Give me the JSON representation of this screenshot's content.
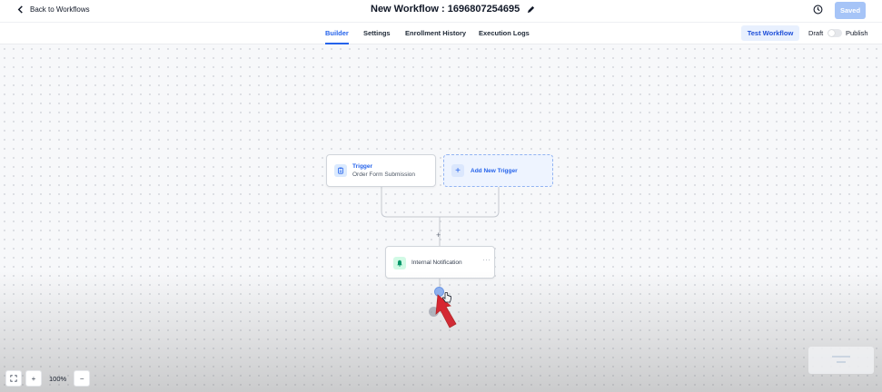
{
  "header": {
    "back_label": "Back to Workflows",
    "workflow_title": "New Workflow : 1696807254695",
    "saved_label": "Saved"
  },
  "tabs": [
    {
      "label": "Builder",
      "active": true
    },
    {
      "label": "Settings",
      "active": false
    },
    {
      "label": "Enrollment History",
      "active": false
    },
    {
      "label": "Execution Logs",
      "active": false
    }
  ],
  "actions": {
    "test_label": "Test Workflow",
    "draft_label": "Draft",
    "publish_label": "Publish",
    "published": false
  },
  "canvas": {
    "trigger": {
      "title": "Trigger",
      "subtitle": "Order Form Submission",
      "icon": "clipboard-icon"
    },
    "add_trigger_label": "Add New Trigger",
    "step": {
      "label": "Internal Notification",
      "icon": "bell-icon",
      "more": "···"
    },
    "connector_plus": "+"
  },
  "zoom": {
    "level": "100%",
    "in_label": "+",
    "out_label": "−"
  },
  "colors": {
    "primary": "#2563eb",
    "saved_btn": "#a6c4f7",
    "annotation_arrow": "#e11d2a"
  }
}
